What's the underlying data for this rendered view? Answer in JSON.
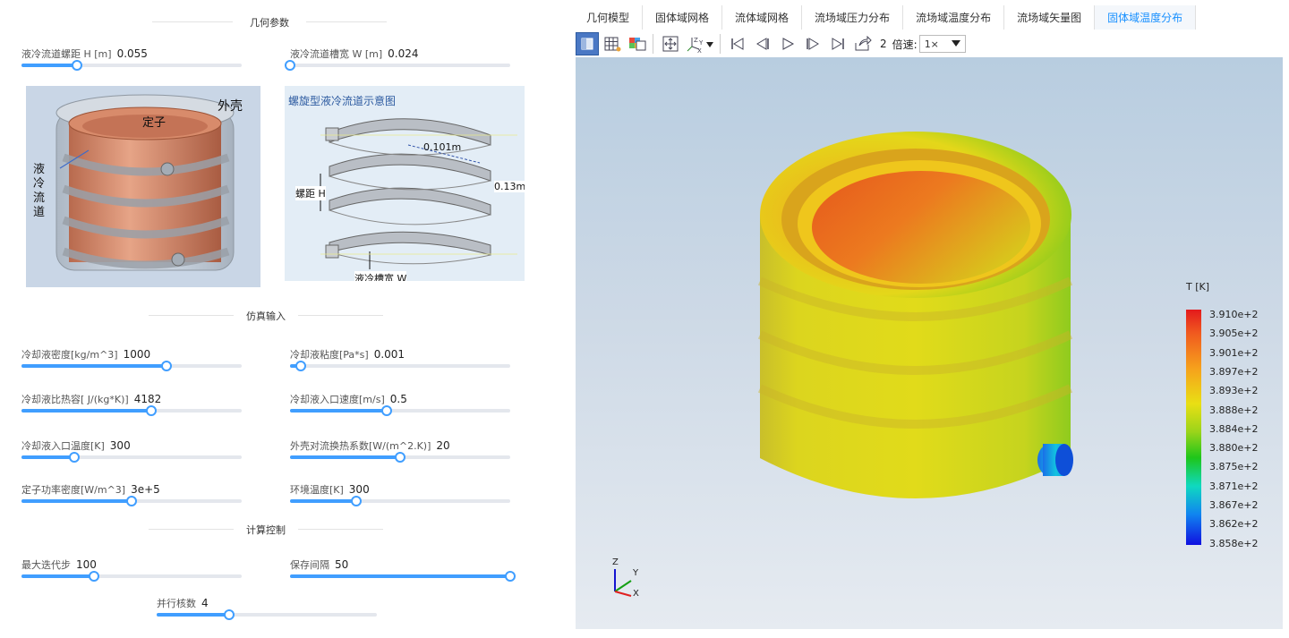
{
  "sections": {
    "geometry": "几何参数",
    "simulation": "仿真输入",
    "control": "计算控制"
  },
  "params": {
    "pitch": {
      "label": "液冷流道螺距 H [m]",
      "value": "0.055",
      "fraction": 0.25
    },
    "slot_width": {
      "label": "液冷流道槽宽 W [m]",
      "value": "0.024",
      "fraction": 0.0
    },
    "density": {
      "label": "冷却液密度[kg/m^3]",
      "value": "1000",
      "fraction": 0.66
    },
    "viscosity": {
      "label": "冷却液粘度[Pa*s]",
      "value": "0.001",
      "fraction": 0.05
    },
    "specific_heat": {
      "label": "冷却液比热容[ J/(kg*K)]",
      "value": "4182",
      "fraction": 0.59
    },
    "inlet_velocity": {
      "label": "冷却液入口速度[m/s]",
      "value": "0.5",
      "fraction": 0.44
    },
    "inlet_temp": {
      "label": "冷却液入口温度[K]",
      "value": "300",
      "fraction": 0.24
    },
    "shell_h": {
      "label": "外壳对流换热系数[W/(m^2.K)]",
      "value": "20",
      "fraction": 0.5
    },
    "stator_power": {
      "label": "定子功率密度[W/m^3]",
      "value": "3e+5",
      "fraction": 0.5
    },
    "ambient_temp": {
      "label": "环境温度[K]",
      "value": "300",
      "fraction": 0.3
    },
    "max_iter": {
      "label": "最大迭代步",
      "value": "100",
      "fraction": 0.33
    },
    "save_interval": {
      "label": "保存间隔",
      "value": "50",
      "fraction": 1.0
    },
    "cores": {
      "label": "并行核数",
      "value": "4",
      "fraction": 0.33
    }
  },
  "figure1": {
    "shell": "外壳",
    "stator": "定子",
    "channel": [
      "液",
      "冷",
      "流",
      "道"
    ]
  },
  "figure2": {
    "title": "螺旋型液冷流道示意图",
    "diameter": "0.101m",
    "pitch": "螺距 H",
    "height": "0.13m",
    "slot": "液冷槽宽 W"
  },
  "tabs": [
    "几何模型",
    "固体域网格",
    "流体域网格",
    "流场域压力分布",
    "流场域温度分布",
    "流场域矢量图",
    "固体域温度分布"
  ],
  "active_tab": 6,
  "toolbar": {
    "frame": "2",
    "speed_label": "倍速:",
    "speed_value": "1×"
  },
  "legend": {
    "title": "T [K]",
    "labels": [
      "3.910e+2",
      "3.905e+2",
      "3.901e+2",
      "3.897e+2",
      "3.893e+2",
      "3.888e+2",
      "3.884e+2",
      "3.880e+2",
      "3.875e+2",
      "3.871e+2",
      "3.867e+2",
      "3.862e+2",
      "3.858e+2"
    ]
  },
  "axes": {
    "z": "Z",
    "y": "Y",
    "x": "X"
  },
  "colors": {
    "accent": "#409eff",
    "tab_active": "#1890ff"
  }
}
